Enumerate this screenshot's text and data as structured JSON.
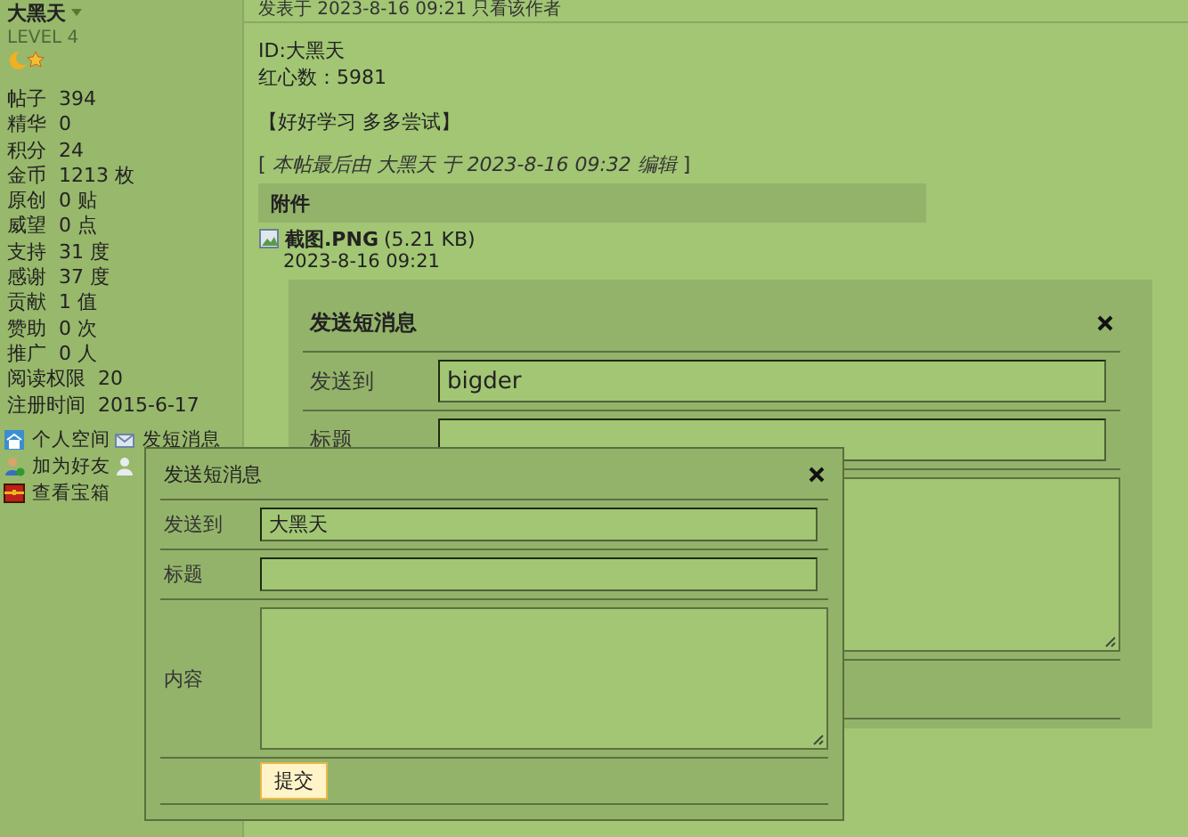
{
  "profile": {
    "username": "大黑天",
    "level": "LEVEL 4",
    "stats": [
      {
        "label": "帖子",
        "value": "394"
      },
      {
        "label": "精华",
        "value": "0"
      },
      {
        "label": "积分",
        "value": "24"
      },
      {
        "label": "金币",
        "value": "1213 枚"
      },
      {
        "label": "原创",
        "value": "0 贴"
      },
      {
        "label": "威望",
        "value": "0 点"
      },
      {
        "label": "支持",
        "value": "31 度"
      },
      {
        "label": "感谢",
        "value": "37 度"
      },
      {
        "label": "贡献",
        "value": "1 值"
      },
      {
        "label": "赞助",
        "value": "0 次"
      },
      {
        "label": "推广",
        "value": "0 人"
      },
      {
        "label": "阅读权限",
        "value": "20"
      },
      {
        "label": "注册时间",
        "value": "2015-6-17"
      }
    ],
    "links": [
      {
        "kind": "home",
        "label": "个人空间"
      },
      {
        "kind": "message",
        "label": "发短消息"
      },
      {
        "kind": "add-friend",
        "label": "加为好友"
      },
      {
        "kind": "person"
      },
      {
        "kind": "chest",
        "label": "查看宝箱"
      }
    ]
  },
  "post": {
    "meta": "发表于 2023-8-16 09:21  只看该作者",
    "lines": [
      "ID:大黑天",
      "红心数：5981"
    ],
    "motto": "【好好学习 多多尝试】",
    "edit_note": "[ *本帖最后由 大黑天 于 2023-8-16 09:32 编辑* ]",
    "attachments_title": "附件",
    "attachment": {
      "name": "截图.PNG",
      "size": "(5.21 KB)",
      "date": "2023-8-16 09:21"
    }
  },
  "dialogs": [
    {
      "title": "发送短消息",
      "fields": [
        {
          "kind": "input",
          "label": "发送到",
          "value": "bigder"
        },
        {
          "kind": "input",
          "label": "标题"
        },
        {
          "kind": "textarea"
        }
      ]
    },
    {
      "title": "发送短消息",
      "submit": "提交",
      "fields": [
        {
          "kind": "input",
          "label": "发送到",
          "value": "大黑天"
        },
        {
          "kind": "input",
          "label": "标题"
        },
        {
          "kind": "textarea",
          "label": "内容"
        }
      ]
    }
  ]
}
